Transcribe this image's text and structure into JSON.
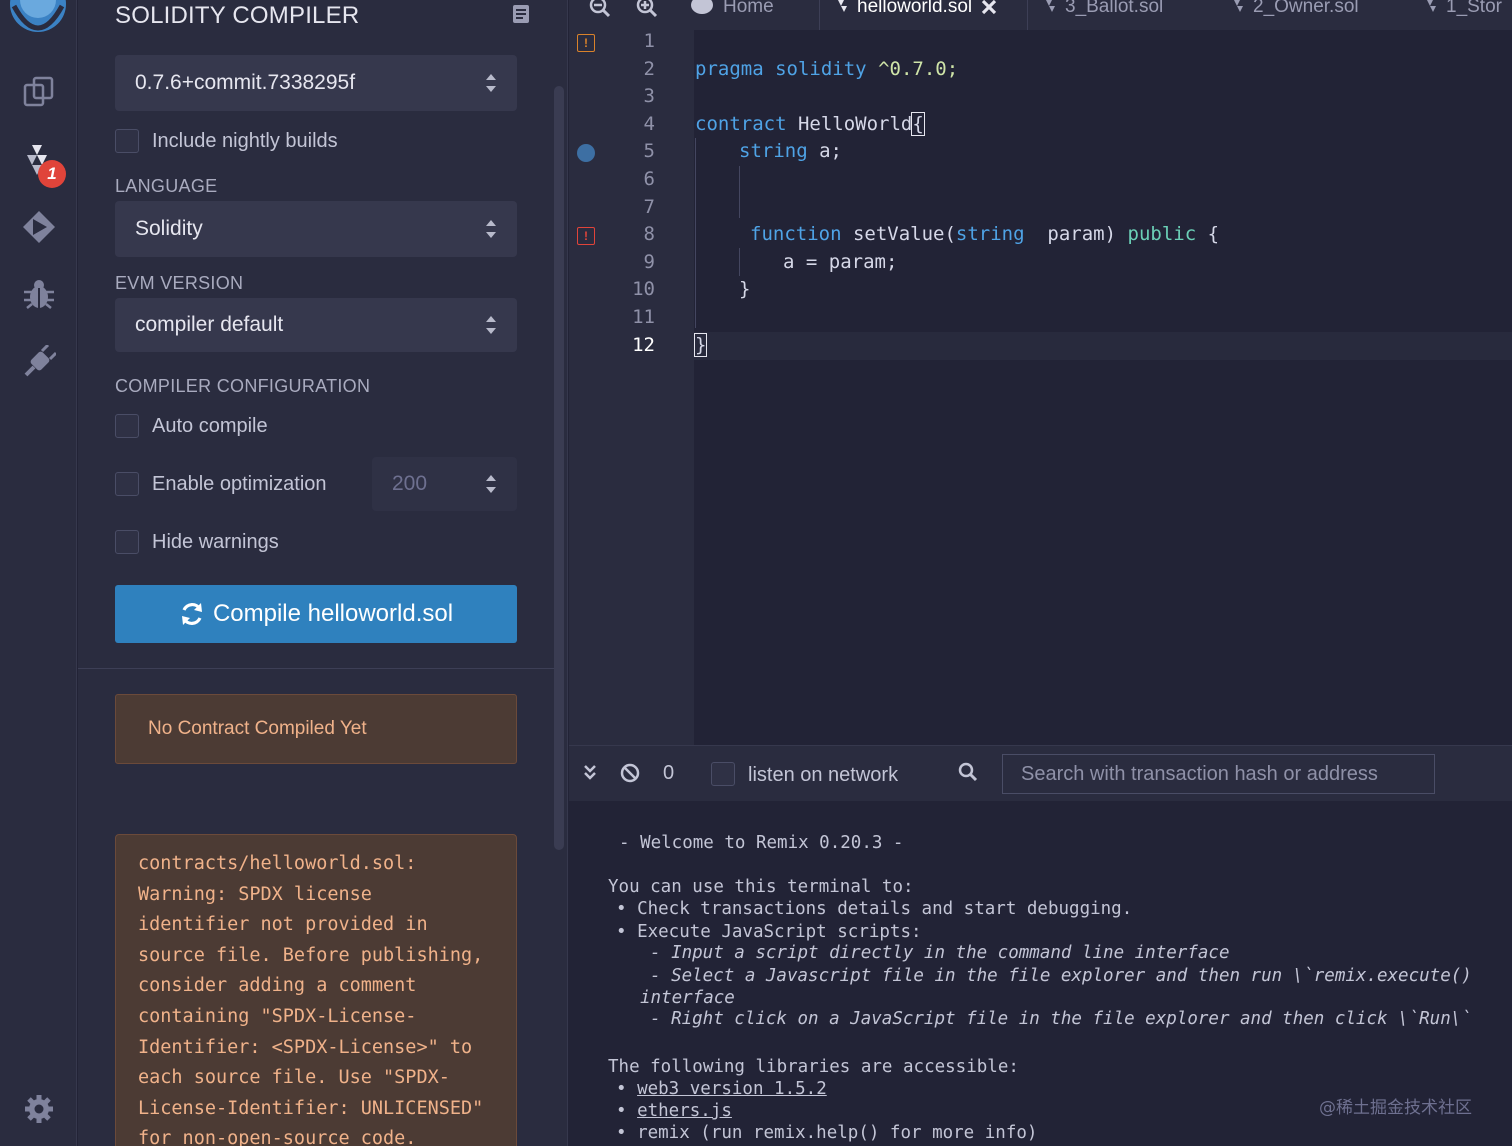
{
  "rail": {
    "badge": "1"
  },
  "panel": {
    "title": "SOLIDITY COMPILER",
    "compiler_version": "0.7.6+commit.7338295f",
    "nightly_label": "Include nightly builds",
    "language_label": "LANGUAGE",
    "language_value": "Solidity",
    "evm_label": "EVM VERSION",
    "evm_value": "compiler default",
    "config_label": "COMPILER CONFIGURATION",
    "auto_compile_label": "Auto compile",
    "optimization_label": "Enable optimization",
    "optimization_runs": "200",
    "hide_warnings_label": "Hide warnings",
    "compile_button": "Compile helloworld.sol",
    "no_contract": "No Contract Compiled Yet",
    "warning_text": "contracts/helloworld.sol:\nWarning: SPDX license\nidentifier not provided in\nsource file. Before publishing,\nconsider adding a comment\ncontaining \"SPDX-License-\nIdentifier: <SPDX-License>\" to\neach source file. Use \"SPDX-\nLicense-Identifier: UNLICENSED\"\nfor non-open-source code."
  },
  "tabs": {
    "home": "Home",
    "active": "helloworld.sol",
    "t2": "3_Ballot.sol",
    "t3": "2_Owner.sol",
    "t4": "1_Stor"
  },
  "editor": {
    "line_numbers": [
      "1",
      "2",
      "3",
      "4",
      "5",
      "6",
      "7",
      "8",
      "9",
      "10",
      "11",
      "12"
    ],
    "l2_kw": "pragma",
    "l2_kw2": "solidity",
    "l2_ver": "^0.7.0;",
    "l4_kw": "contract",
    "l4_name": "HelloWorld",
    "l4_brace": "{",
    "l5_type": "string",
    "l5_rest": " a;",
    "l8_kw": "function",
    "l8_name": " setValue(",
    "l8_type": "string",
    "l8_param": "  param) ",
    "l8_pub": "public",
    "l8_brace": " {",
    "l9_code": "a = param;",
    "l10_code": "}",
    "l12_code": "}"
  },
  "terminal_bar": {
    "count": "0",
    "listen_label": "listen on network",
    "search_placeholder": "Search with transaction hash or address"
  },
  "terminal": {
    "welcome": "- Welcome to Remix 0.20.3 -",
    "intro": "You can use this terminal to:",
    "b1": "• Check transactions details and start debugging.",
    "b2": "• Execute JavaScript scripts:",
    "b2a": "- Input a script directly in the command line interface",
    "b2b": "- Select a Javascript file in the file explorer and then run \\`remix.execute()",
    "b2b_cont": "interface",
    "b2c": "- Right click on a JavaScript file in the file explorer and then click \\`Run\\`",
    "libs": "The following libraries are accessible:",
    "lib1": "web3 version 1.5.2",
    "lib2": "ethers.js",
    "lib3": "• remix (run remix.help() for more info)",
    "watermark": "@稀土掘金技术社区"
  }
}
